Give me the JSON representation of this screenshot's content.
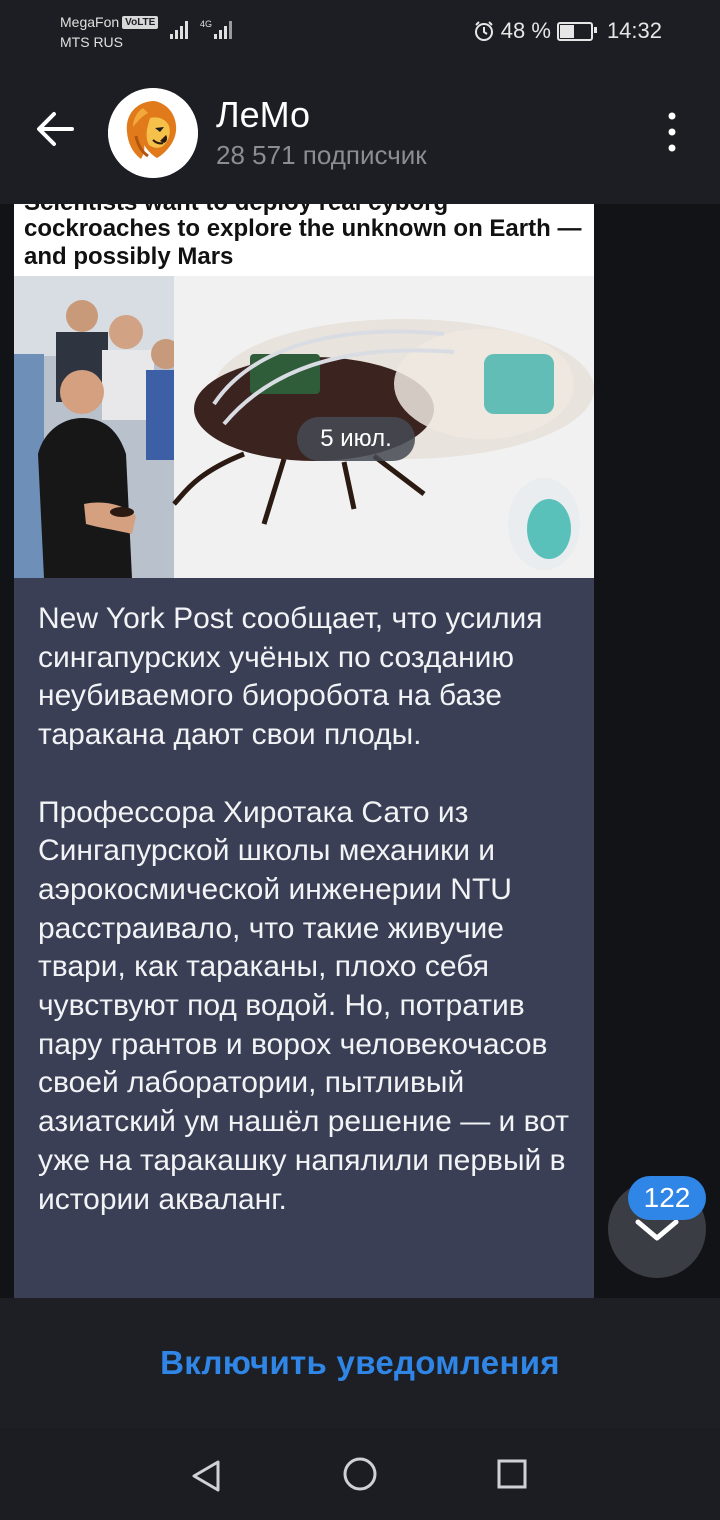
{
  "status_bar": {
    "carrier_1": "MegaFon",
    "volte": "VoLTE",
    "carrier_2": "MTS RUS",
    "network": "4G",
    "battery": "48 %",
    "battery_level": 0.48,
    "time": "14:32"
  },
  "header": {
    "title": "ЛеМо",
    "subscribers": "28 571 подписчик"
  },
  "post": {
    "date": "5 июл.",
    "image_headline_1": "Scientists want to deploy real cyborg",
    "image_headline_2": "cockroaches to explore the unknown on Earth —",
    "image_headline_3": "and possibly Mars",
    "text": "New York Post сообщает, что усилия сингапурских учёных по созданию неубиваемого биоробота на базе таракана дают свои плоды.\n\nПрофессора Хиротака Сато из Сингапурской школы механики и аэрокосмической инженерии NTU расстраивало, что такие живучие твари, как тараканы, плохо себя чувствуют под водой. Но, потратив пару грантов и ворох человекочасов своей лаборатории, пытливый азиатский ум нашёл решение — и вот уже на таракашку напялили первый в истории акваланг."
  },
  "scroll_down": {
    "unread_count": "122"
  },
  "bottom": {
    "notify_label": "Включить уведомления"
  },
  "colors": {
    "accent": "#2f86e6",
    "bubble": "#3a3f56",
    "header_bg": "#1c1e23"
  }
}
